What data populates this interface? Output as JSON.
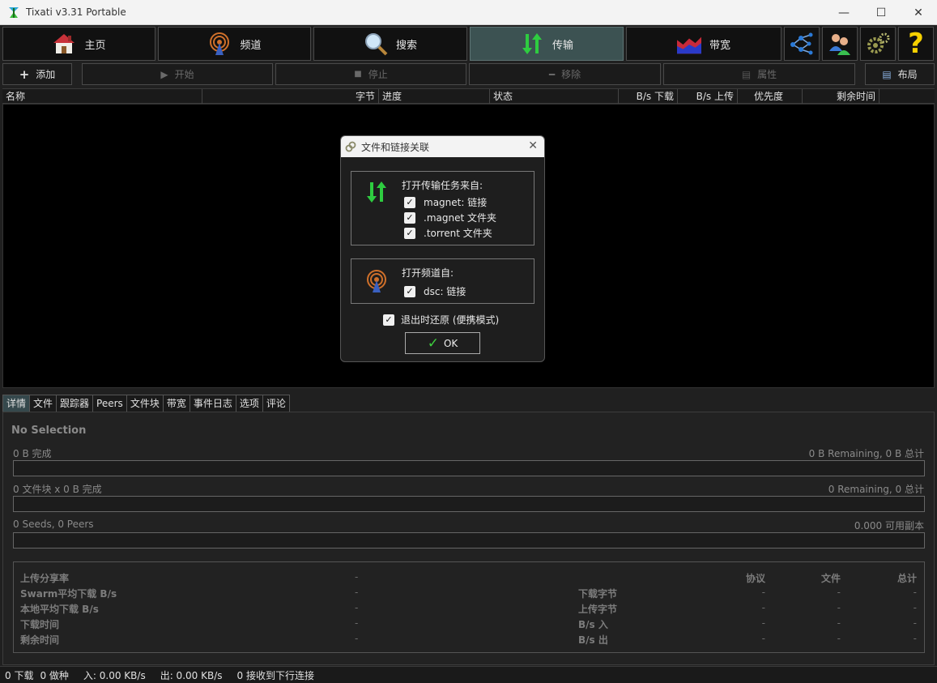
{
  "window": {
    "title": "Tixati v3.31 Portable",
    "minimize": "—",
    "maximize": "☐",
    "close": "✕"
  },
  "toolbar": {
    "home": "主页",
    "channels": "频道",
    "search": "搜索",
    "transfers": "传输",
    "bandwidth": "带宽",
    "active_tab": "transfers"
  },
  "actions": {
    "add": "添加",
    "start": "开始",
    "stop": "停止",
    "remove": "移除",
    "properties": "属性",
    "layout": "布局"
  },
  "columns": [
    "名称",
    "字节",
    "进度",
    "状态",
    "B/s 下载",
    "B/s 上传",
    "优先度",
    "剩余时间"
  ],
  "dialog": {
    "title": "文件和链接关联",
    "transfers_heading": "打开传输任务来自:",
    "transfer_options": [
      {
        "label": "magnet: 链接",
        "checked": true
      },
      {
        "label": ".magnet 文件夹",
        "checked": true
      },
      {
        "label": ".torrent 文件夹",
        "checked": true
      }
    ],
    "channels_heading": "打开频道自:",
    "channel_options": [
      {
        "label": "dsc: 链接",
        "checked": true
      }
    ],
    "restore_label": "退出时还原 (便携模式)",
    "restore_checked": true,
    "ok_label": "OK"
  },
  "bottom_tabs": [
    "详情",
    "文件",
    "跟踪器",
    "Peers",
    "文件块",
    "带宽",
    "事件日志",
    "选项",
    "评论"
  ],
  "details": {
    "selection": "No Selection",
    "row1_left": "0 B 完成",
    "row1_right": "0 B Remaining,  0 B 总计",
    "row2_left": "0 文件块  x  0 B 完成",
    "row2_right": "0 Remaining,  0 总计",
    "row3_left": "0 Seeds, 0 Peers",
    "row3_right": "0.000 可用副本"
  },
  "stats": {
    "left_labels": [
      "上传分享率",
      "Swarm平均下载 B/s",
      "本地平均下载 B/s",
      "下载时间",
      "剩余时间"
    ],
    "left_values": [
      "-",
      "-",
      "-",
      "-",
      "-"
    ],
    "headers": [
      "协议",
      "文件",
      "总计"
    ],
    "right_labels": [
      "下载字节",
      "上传字节",
      "B/s 入",
      "B/s 出"
    ],
    "right_values": [
      [
        "-",
        "-",
        "-"
      ],
      [
        "-",
        "-",
        "-"
      ],
      [
        "-",
        "-",
        "-"
      ],
      [
        "-",
        "-",
        "-"
      ]
    ]
  },
  "statusbar": {
    "downloads": "0 下载",
    "seeding": "0 做种",
    "in_rate": "入: 0.00 KB/s",
    "out_rate": "出: 0.00 KB/s",
    "connections": "0 接收到下行连接"
  }
}
